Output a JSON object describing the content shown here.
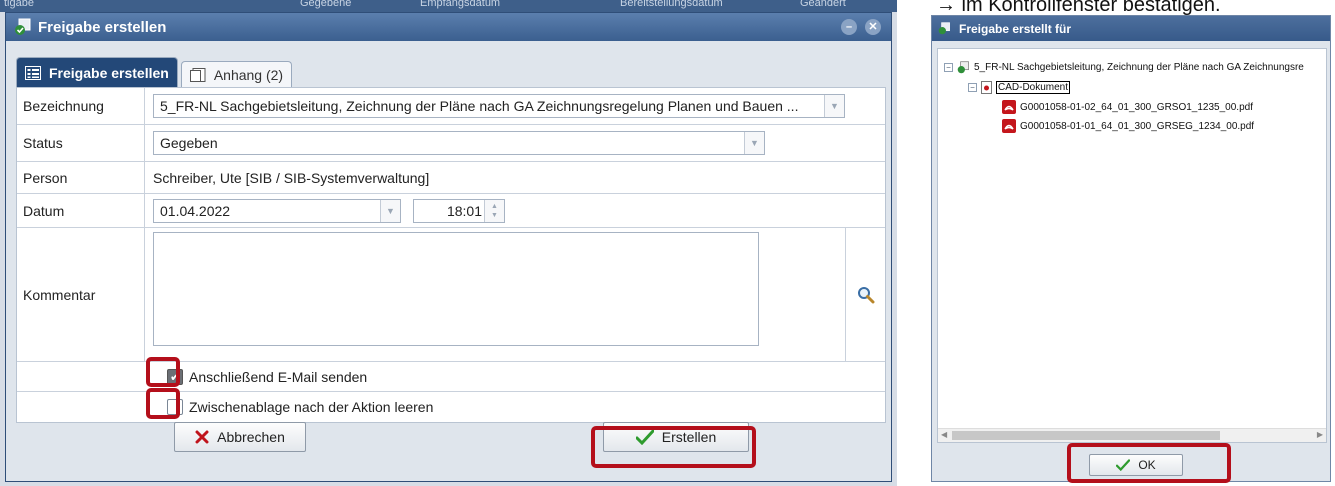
{
  "background": {
    "top_labels": [
      "tigabe",
      "Gegebene",
      "Empfangsdatum",
      "Bereitstellungsdatum",
      "Geändert"
    ]
  },
  "dialog": {
    "title": "Freigabe erstellen",
    "tabs": [
      {
        "label": "Freigabe erstellen",
        "active": true
      },
      {
        "label": "Anhang (2)",
        "active": false
      }
    ],
    "fields": {
      "bezeichnung_label": "Bezeichnung",
      "bezeichnung_value": "5_FR-NL Sachgebietsleitung, Zeichnung der Pläne nach GA Zeichnungsregelung Planen und Bauen ...",
      "status_label": "Status",
      "status_value": "Gegeben",
      "person_label": "Person",
      "person_value": "Schreiber, Ute [SIB / SIB-Systemverwaltung]",
      "datum_label": "Datum",
      "datum_value": "01.04.2022",
      "time_value": "18:01",
      "kommentar_label": "Kommentar",
      "kommentar_value": ""
    },
    "checkboxes": [
      {
        "label": "Anschließend E-Mail senden",
        "checked": true
      },
      {
        "label": "Zwischenablage nach der Aktion leeren",
        "checked": false
      }
    ],
    "buttons": {
      "cancel": "Abbrechen",
      "create": "Erstellen"
    }
  },
  "right_panel": {
    "caption": "→ im Kontrollfenster bestätigen.",
    "title": "Freigabe erstellt für",
    "tree": {
      "root": "5_FR-NL Sachgebietsleitung, Zeichnung der Pläne nach GA Zeichnungsre",
      "folder": "CAD-Dokument",
      "files": [
        "G0001058-01-02_64_01_300_GRSO1_1235_00.pdf",
        "G0001058-01-01_64_01_300_GRSEG_1234_00.pdf"
      ]
    },
    "ok_label": "OK"
  },
  "colors": {
    "title_bar": "#3b5f8f",
    "active_tab": "#234878",
    "highlight_red": "#b40f1b",
    "check_green": "#2e9b2e",
    "cancel_red": "#c0141c"
  }
}
